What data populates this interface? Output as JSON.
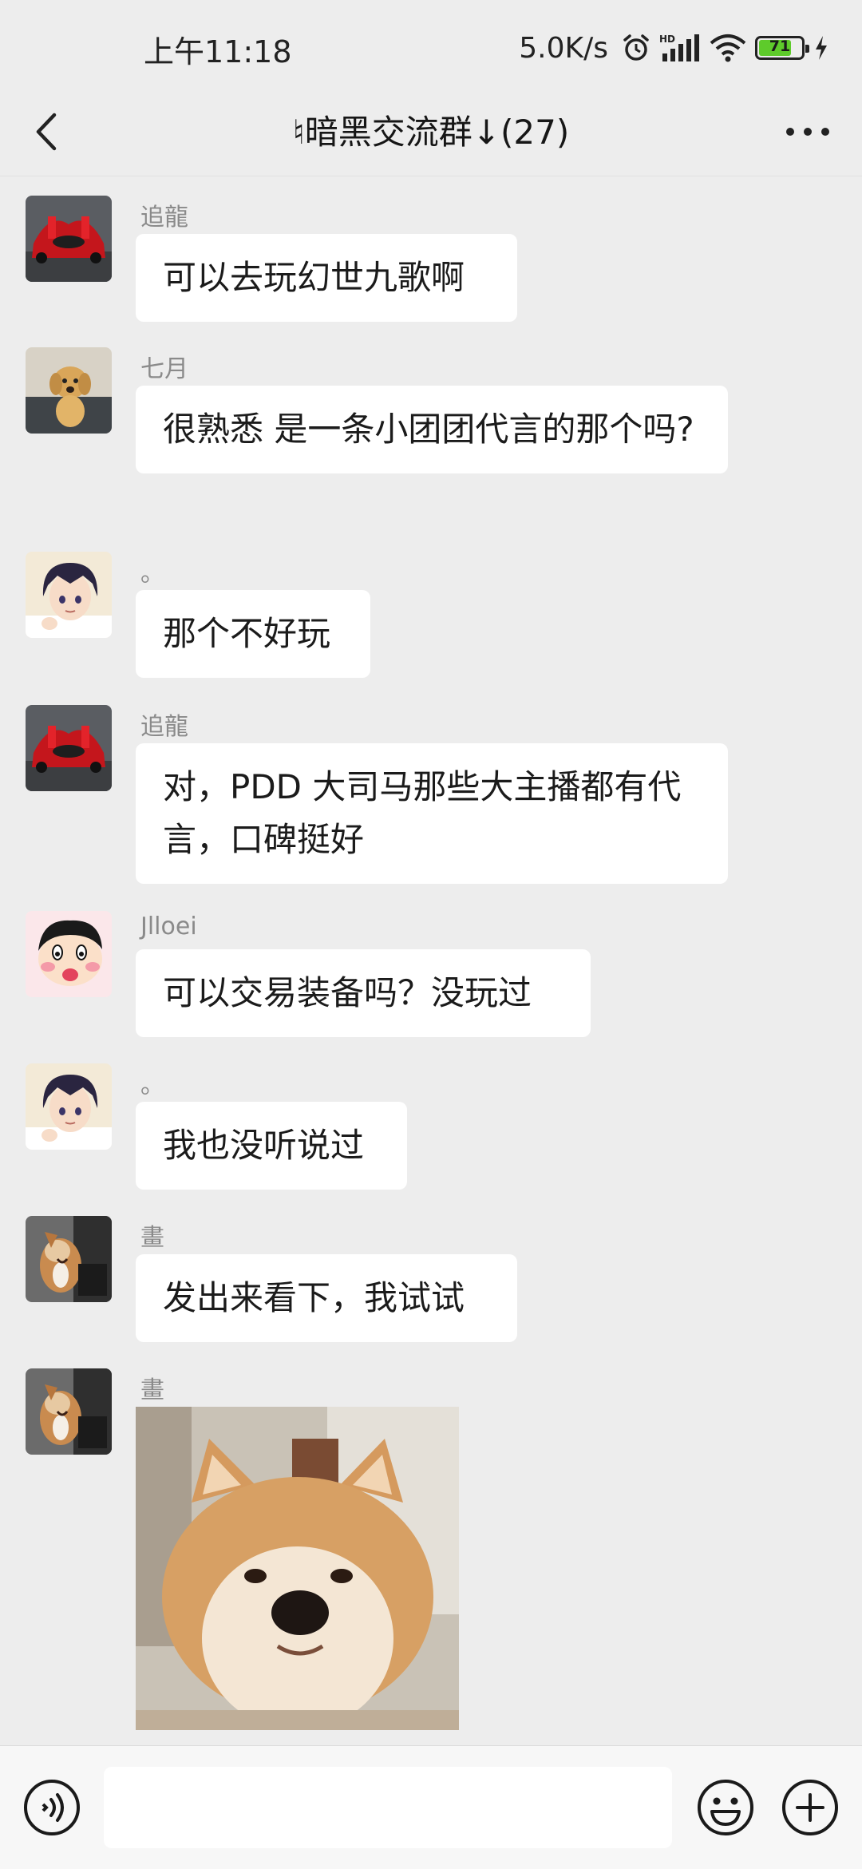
{
  "status_bar": {
    "time": "上午11:18",
    "net_speed": "5.0K/s",
    "battery": "71",
    "battery_level_percent": 71,
    "icons": [
      "alarm-icon",
      "hd-signal-icon",
      "wifi-icon",
      "battery-icon",
      "charging-icon"
    ]
  },
  "nav": {
    "title": "♮暗黑交流群↓(27)",
    "icons": [
      "back-chevron-icon",
      "more-dots-icon"
    ]
  },
  "messages": [
    {
      "sender": "追龍",
      "text": "可以去玩幻世九歌啊",
      "avatar": "red-car"
    },
    {
      "sender": "七月",
      "text": "很熟悉 是一条小团团代言的那个吗?",
      "avatar": "golden-dog"
    },
    {
      "sender": "。",
      "text": "那个不好玩",
      "avatar": "anime-boy"
    },
    {
      "sender": "追龍",
      "text": "对，PDD 大司马那些大主播都有代言，口碑挺好",
      "avatar": "red-car"
    },
    {
      "sender": "Jlloei",
      "text": "可以交易装备吗？没玩过",
      "avatar": "crayon-shin"
    },
    {
      "sender": "。",
      "text": "我也没听说过",
      "avatar": "anime-boy"
    },
    {
      "sender": "畫",
      "text": "发出来看下，我试试",
      "avatar": "corgi-car"
    },
    {
      "sender": "畫",
      "text": "",
      "avatar": "corgi-car",
      "image": "shiba-inu-photo"
    }
  ],
  "input_bar": {
    "icons": [
      "voice-icon",
      "emoji-icon",
      "plus-icon"
    ],
    "value": ""
  },
  "colors": {
    "background": "#ededed",
    "bubble": "#ffffff",
    "sender_text": "#8a8a8a",
    "battery_green": "#5ecb2b"
  }
}
